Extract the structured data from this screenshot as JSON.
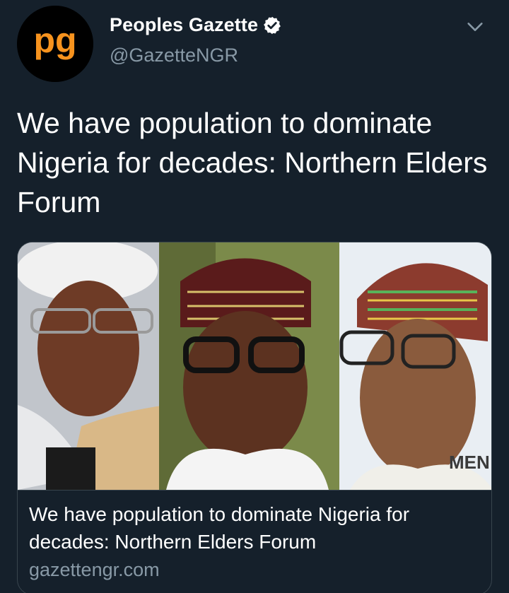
{
  "author": {
    "display_name": "Peoples Gazette",
    "handle": "@GazetteNGR",
    "avatar_text": "pg",
    "verified": true,
    "avatar_color": "#f7931e"
  },
  "tweet": {
    "text": "We have population to dominate Nigeria for decades: Northern Elders Forum"
  },
  "card": {
    "title": "We have population to dominate Nigeria for decades: Northern Elders Forum",
    "domain": "gazettengr.com",
    "image_text": "MEN"
  },
  "icons": {
    "verified": "verified-badge-icon",
    "menu": "chevron-down-icon"
  },
  "colors": {
    "background": "#15202b",
    "text_primary": "#ffffff",
    "text_secondary": "#8899a6",
    "border": "#38444d"
  }
}
